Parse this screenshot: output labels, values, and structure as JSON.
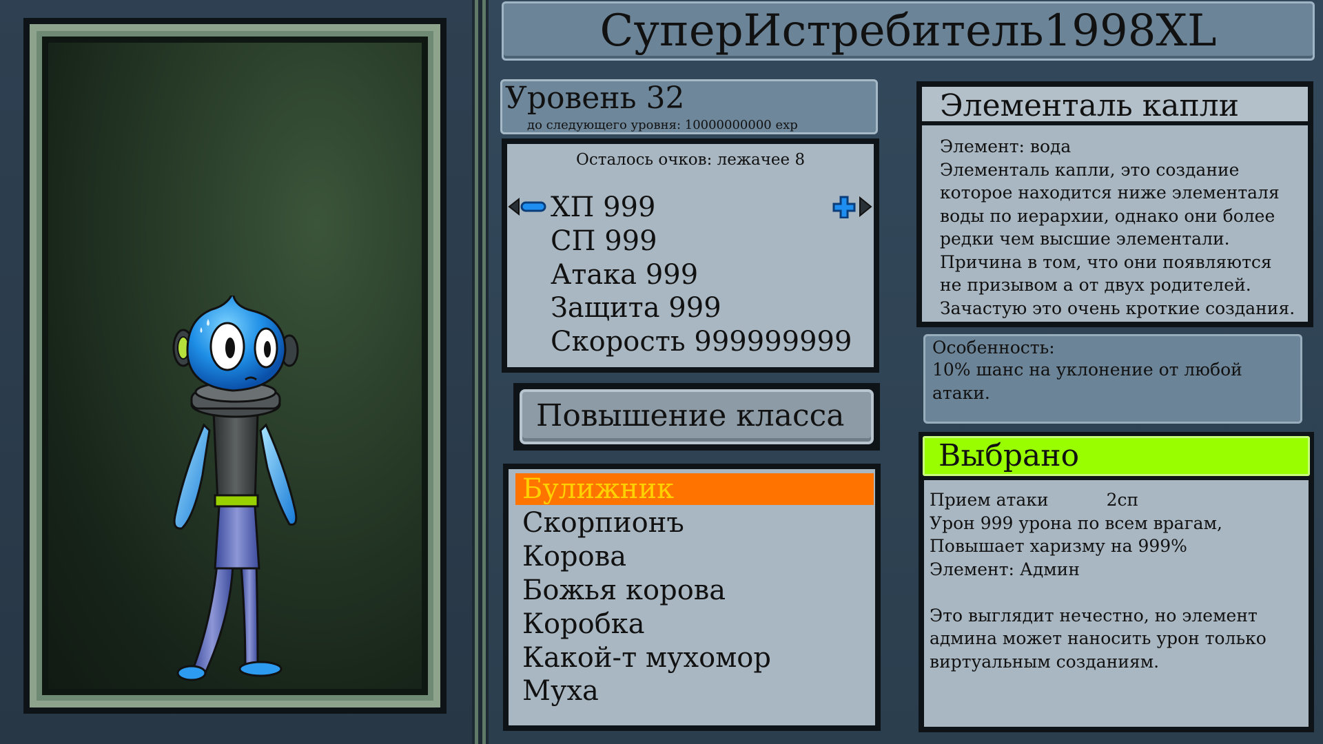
{
  "character": {
    "name": "СуперИстребитель1998XL",
    "level": "Уровень 32",
    "to_next_level": "до следующего уровня: 10000000000 exp"
  },
  "stats": {
    "points_left": "Осталось очков: лежачее 8",
    "rows": [
      {
        "label": "ХП 999"
      },
      {
        "label": "СП 999"
      },
      {
        "label": "Атака 999"
      },
      {
        "label": "Защита 999"
      },
      {
        "label": "Скорость 999999999"
      }
    ]
  },
  "class_up_button": "Повышение класса",
  "class_list": {
    "items": [
      "Булижник",
      "Скорпионъ",
      "Корова",
      "Божья корова",
      "Коробка",
      "Какой-т мухомор",
      "Муха"
    ],
    "selected_index": 0
  },
  "element_info": {
    "title": "Элементаль капли",
    "lines": [
      "Элемент: вода",
      "Элементаль капли, это создание",
      "которое находится ниже элементаля",
      "воды по иерархии, однако они более",
      "редки чем высшие элементали.",
      "Причина в том, что они появляются",
      "не призывом а от двух родителей.",
      "Зачастую это очень кроткие создания."
    ]
  },
  "feature": {
    "label": "Особенность:",
    "text": "10% шанс на уклонение от любой атаки."
  },
  "selected_skill": {
    "header": "Выбрано",
    "name": "Прием атаки",
    "cost": "2сп",
    "lines": [
      "Урон   999 урона по всем врагам,",
      "Повышает харизму на 999%",
      "Элемент: Админ",
      "",
      "Это выглядит нечестно, но элемент",
      "админа может наносить урон только",
      "виртуальным созданиям."
    ]
  },
  "icons": {
    "decrease": "minus-arrow-left-icon",
    "increase": "plus-arrow-right-icon"
  },
  "colors": {
    "selected_item_bg": "#ff7400",
    "selected_item_text": "#ffd100",
    "selected_header": "#99ff00",
    "panel": "#a9b7c2"
  }
}
